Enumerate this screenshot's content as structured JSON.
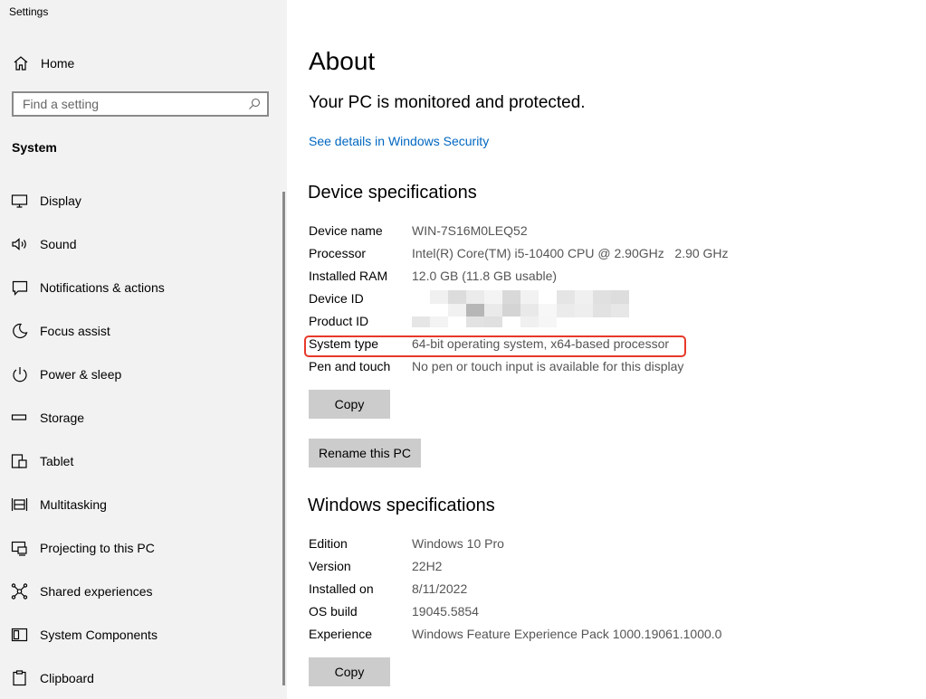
{
  "app": {
    "title": "Settings"
  },
  "sidebar": {
    "home_label": "Home",
    "search_placeholder": "Find a setting",
    "section_title": "System",
    "items": [
      {
        "label": "Display",
        "icon": "display-icon"
      },
      {
        "label": "Sound",
        "icon": "sound-icon"
      },
      {
        "label": "Notifications & actions",
        "icon": "notifications-icon"
      },
      {
        "label": "Focus assist",
        "icon": "moon-icon"
      },
      {
        "label": "Power & sleep",
        "icon": "power-icon"
      },
      {
        "label": "Storage",
        "icon": "storage-icon"
      },
      {
        "label": "Tablet",
        "icon": "tablet-icon"
      },
      {
        "label": "Multitasking",
        "icon": "multitasking-icon"
      },
      {
        "label": "Projecting to this PC",
        "icon": "projecting-icon"
      },
      {
        "label": "Shared experiences",
        "icon": "shared-experiences-icon"
      },
      {
        "label": "System Components",
        "icon": "system-components-icon"
      },
      {
        "label": "Clipboard",
        "icon": "clipboard-icon"
      }
    ]
  },
  "main": {
    "title": "About",
    "protection_text": "Your PC is monitored and protected.",
    "security_link": "See details in Windows Security",
    "device_heading": "Device specifications",
    "device_specs": {
      "device_name": {
        "key": "Device name",
        "value": "WIN-7S16M0LEQ52"
      },
      "processor": {
        "key": "Processor",
        "value": "Intel(R) Core(TM) i5-10400 CPU @ 2.90GHz   2.90 GHz"
      },
      "ram": {
        "key": "Installed RAM",
        "value": "12.0 GB (11.8 GB usable)"
      },
      "device_id": {
        "key": "Device ID"
      },
      "product_id": {
        "key": "Product ID"
      },
      "system_type": {
        "key": "System type",
        "value": "64-bit operating system, x64-based processor"
      },
      "pen_touch": {
        "key": "Pen and touch",
        "value": "No pen or touch input is available for this display"
      }
    },
    "copy_label": "Copy",
    "rename_label": "Rename this PC",
    "windows_heading": "Windows specifications",
    "windows_specs": {
      "edition": {
        "key": "Edition",
        "value": "Windows 10 Pro"
      },
      "version": {
        "key": "Version",
        "value": "22H2"
      },
      "installed_on": {
        "key": "Installed on",
        "value": "8/11/2022"
      },
      "os_build": {
        "key": "OS build",
        "value": "19045.5854"
      },
      "experience": {
        "key": "Experience",
        "value": "Windows Feature Experience Pack 1000.19061.1000.0"
      }
    },
    "copy2_label": "Copy"
  },
  "colors": {
    "sidebar_bg": "#f2f2f2",
    "link": "#0067c0",
    "highlight": "#e8382a",
    "button_bg": "#cccccc",
    "value_text": "#555555"
  }
}
